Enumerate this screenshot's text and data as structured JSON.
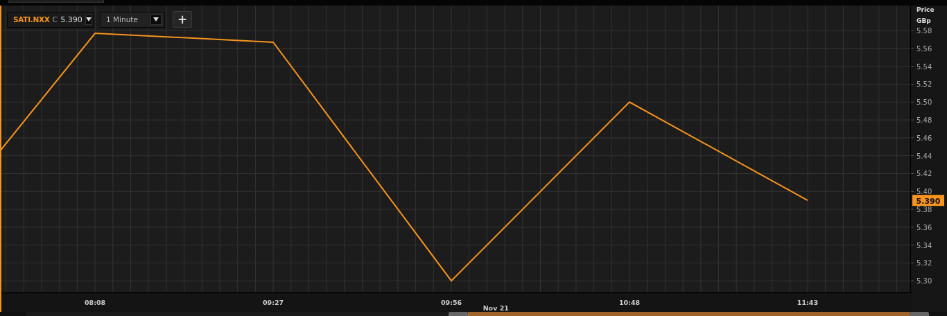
{
  "toolbar": {
    "symbol": "SATI.NXX",
    "close_label": "C",
    "close_value": "5.390",
    "interval": "1 Minute",
    "add_button": "+"
  },
  "chart": {
    "chart_data": {
      "type": "line",
      "ylabel": "Price",
      "grid": true,
      "categories": [
        null,
        "08:08",
        "09:27",
        "09:56",
        "10:48",
        "11:43"
      ],
      "series": [
        {
          "color": "#f7931e",
          "values": [
            5.33,
            5.577,
            5.567,
            5.3,
            5.5,
            5.39
          ]
        }
      ],
      "ylim": [
        5.287,
        5.608
      ],
      "yticks": [
        {
          "value": 5.3,
          "label": "5.30"
        },
        {
          "value": 5.32,
          "label": "5.32"
        },
        {
          "value": 5.34,
          "label": "5.34"
        },
        {
          "value": 5.36,
          "label": "5.36"
        },
        {
          "value": 5.38,
          "label": "5.38"
        },
        {
          "value": 5.4,
          "label": "5.40"
        },
        {
          "value": 5.42,
          "label": "5.42"
        },
        {
          "value": 5.44,
          "label": "5.44"
        },
        {
          "value": 5.46,
          "label": "5.46"
        },
        {
          "value": 5.48,
          "label": "5.48"
        },
        {
          "value": 5.5,
          "label": "5.50"
        },
        {
          "value": 5.52,
          "label": "5.52"
        },
        {
          "value": 5.54,
          "label": "5.54"
        },
        {
          "value": 5.56,
          "label": "5.56"
        },
        {
          "value": 5.58,
          "label": "5.58"
        }
      ],
      "annotations": [
        "Nov 21"
      ]
    },
    "unit": "GBp",
    "current_price": {
      "label": "5.390"
    }
  }
}
